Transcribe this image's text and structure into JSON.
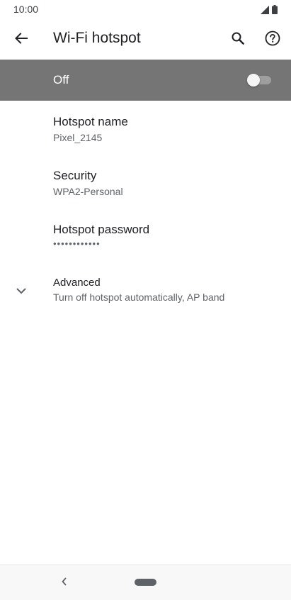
{
  "status_bar": {
    "time": "10:00",
    "signal_icon": "signal-icon",
    "battery_icon": "battery-icon"
  },
  "app_bar": {
    "title": "Wi-Fi hotspot",
    "back_icon": "arrow-back-icon",
    "search_icon": "search-icon",
    "help_icon": "help-icon"
  },
  "master_switch": {
    "label": "Off",
    "checked": false,
    "background": "#757575"
  },
  "preferences": [
    {
      "title": "Hotspot name",
      "summary": "Pixel_2145"
    },
    {
      "title": "Security",
      "summary": "WPA2-Personal"
    },
    {
      "title": "Hotspot password",
      "summary": "••••••••••••"
    },
    {
      "title": "Advanced",
      "summary": "Turn off hotspot automatically, AP band",
      "icon": "chevron-down-icon"
    }
  ],
  "nav_bar": {
    "back_icon": "nav-back-icon",
    "home_icon": "home-pill-icon"
  }
}
